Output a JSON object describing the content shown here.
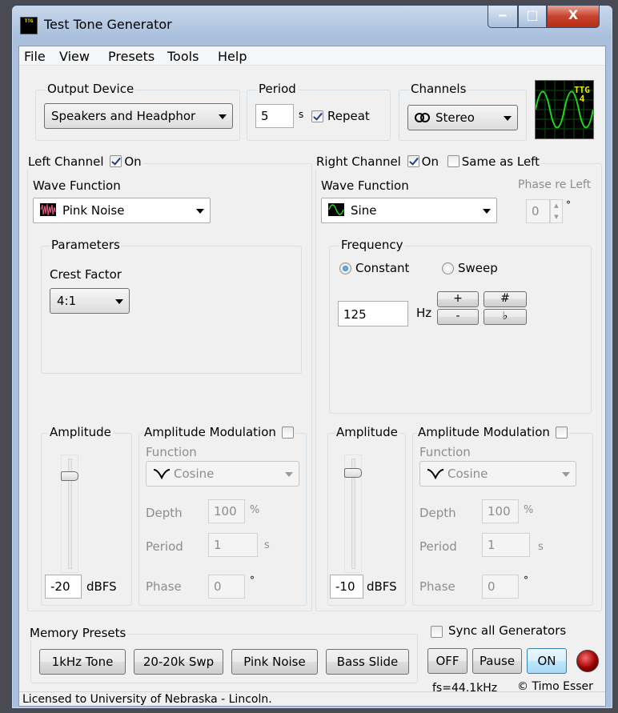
{
  "window": {
    "title": "Test Tone Generator",
    "app_icon_text": "TTG",
    "minimize_glyph": "‒",
    "maximize_glyph": "□",
    "close_glyph": "X"
  },
  "menu": [
    "File",
    "View",
    "Presets",
    "Tools",
    "Help"
  ],
  "output": {
    "label": "Output Device",
    "value": "Speakers and Headphor"
  },
  "period": {
    "label": "Period",
    "value": "5",
    "unit": "s",
    "repeat_label": "Repeat",
    "repeat_checked": true
  },
  "channels": {
    "label": "Channels",
    "value": "Stereo",
    "icon": "stereo-rings-icon"
  },
  "logo": {
    "text_line1": "TTG",
    "text_line2": "4"
  },
  "left": {
    "label": "Left Channel",
    "on_label": "On",
    "on_checked": true,
    "wave_label": "Wave Function",
    "wave_value": "Pink Noise",
    "wave_icon": "pink-noise-icon",
    "params_label": "Parameters",
    "crest_label": "Crest Factor",
    "crest_value": "4:1",
    "amp_label": "Amplitude",
    "amp_value": "-20",
    "amp_unit": "dBFS",
    "amp_level": 0.25,
    "am_label": "Amplitude Modulation",
    "am_checked": false,
    "fn_label": "Function",
    "fn_value": "Cosine",
    "depth_label": "Depth",
    "depth_value": "100",
    "depth_unit": "%",
    "period_label": "Period",
    "period_value": "1",
    "period_unit": "s",
    "phase_label": "Phase",
    "phase_value": "0",
    "phase_unit": "°"
  },
  "right": {
    "label": "Right Channel",
    "on_label": "On",
    "on_checked": true,
    "same_label": "Same as Left",
    "same_checked": false,
    "wave_label": "Wave Function",
    "wave_value": "Sine",
    "wave_icon": "sine-wave-icon",
    "phase_re_left_label": "Phase re Left",
    "phase_re_left_value": "0",
    "phase_re_left_unit": "°",
    "freq_label": "Frequency",
    "constant_label": "Constant",
    "sweep_label": "Sweep",
    "mode_selected": "Constant",
    "freq_value": "125",
    "freq_unit": "Hz",
    "plus_label": "+",
    "minus_label": "-",
    "sharp_label": "#",
    "flat_label": "♭",
    "amp_label": "Amplitude",
    "amp_value": "-10",
    "amp_unit": "dBFS",
    "amp_level": 0.2,
    "am_label": "Amplitude Modulation",
    "am_checked": false,
    "fn_label": "Function",
    "fn_value": "Cosine",
    "depth_label": "Depth",
    "depth_value": "100",
    "depth_unit": "%",
    "period_label": "Period",
    "period_value": "1",
    "period_unit": "s",
    "phase_label": "Phase",
    "phase_value": "0",
    "phase_unit": "°"
  },
  "presets": {
    "label": "Memory Presets",
    "buttons": [
      "1kHz Tone",
      "20-20k Swp",
      "Pink Noise",
      "Bass Slide"
    ]
  },
  "transport": {
    "sync_label": "Sync all Generators",
    "sync_checked": false,
    "off_label": "OFF",
    "pause_label": "Pause",
    "on_label": "ON",
    "fs_text": "fs=44.1kHz",
    "copyright": "© Timo Esser",
    "led_color": "#9a0000"
  },
  "status": "Licensed to University of Nebraska - Lincoln."
}
